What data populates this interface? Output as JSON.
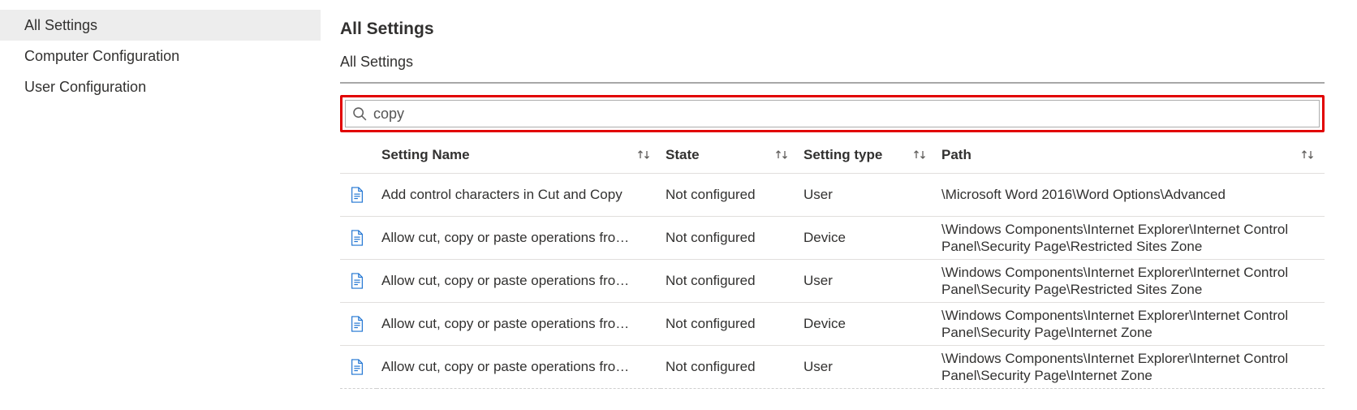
{
  "sidebar": {
    "items": [
      {
        "label": "All Settings",
        "selected": true
      },
      {
        "label": "Computer Configuration",
        "selected": false
      },
      {
        "label": "User Configuration",
        "selected": false
      }
    ]
  },
  "header": {
    "title": "All Settings",
    "breadcrumb": "All Settings"
  },
  "search": {
    "value": "copy"
  },
  "table": {
    "columns": {
      "name": "Setting Name",
      "state": "State",
      "type": "Setting type",
      "path": "Path"
    },
    "rows": [
      {
        "name": "Add control characters in Cut and Copy",
        "state": "Not configured",
        "type": "User",
        "path": "\\Microsoft Word 2016\\Word Options\\Advanced"
      },
      {
        "name": "Allow cut, copy or paste operations fro…",
        "state": "Not configured",
        "type": "Device",
        "path": "\\Windows Components\\Internet Explorer\\Internet Control Panel\\Security Page\\Restricted Sites Zone"
      },
      {
        "name": "Allow cut, copy or paste operations fro…",
        "state": "Not configured",
        "type": "User",
        "path": "\\Windows Components\\Internet Explorer\\Internet Control Panel\\Security Page\\Restricted Sites Zone"
      },
      {
        "name": "Allow cut, copy or paste operations fro…",
        "state": "Not configured",
        "type": "Device",
        "path": "\\Windows Components\\Internet Explorer\\Internet Control Panel\\Security Page\\Internet Zone"
      },
      {
        "name": "Allow cut, copy or paste operations fro…",
        "state": "Not configured",
        "type": "User",
        "path": "\\Windows Components\\Internet Explorer\\Internet Control Panel\\Security Page\\Internet Zone"
      }
    ]
  }
}
